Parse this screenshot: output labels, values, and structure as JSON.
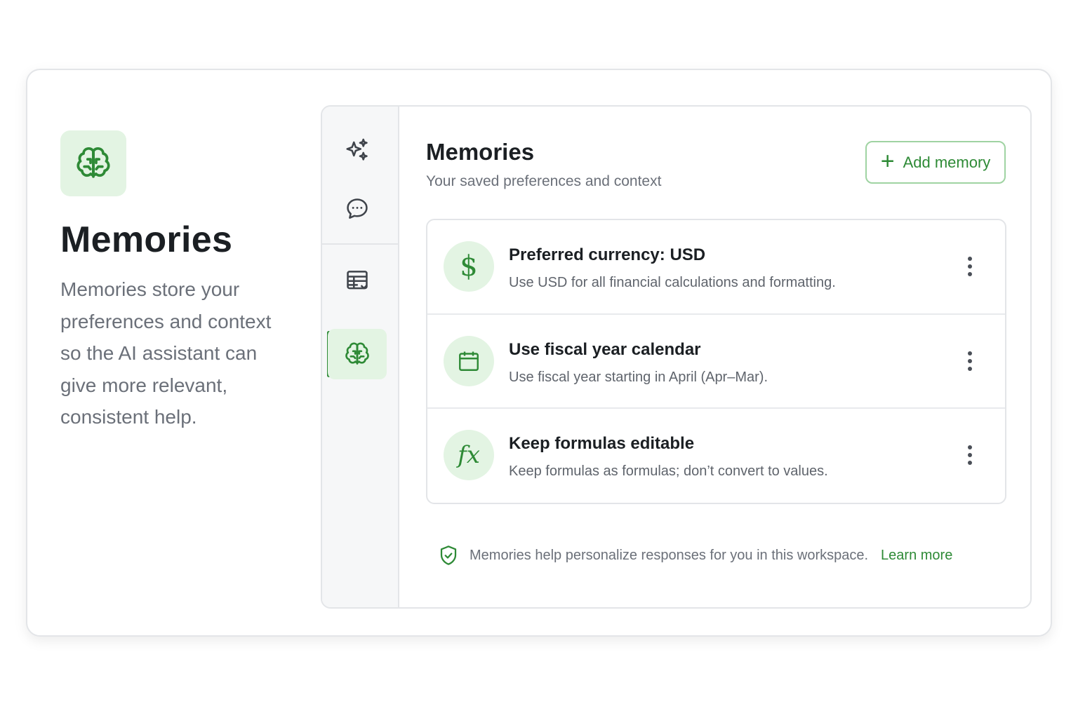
{
  "intro": {
    "icon": "brain-icon",
    "title": "Memories",
    "description": "Memories store your preferences and context so the AI assistant can give more relevant, consistent help."
  },
  "rail": {
    "items": [
      {
        "icon": "sparkles-icon",
        "active": false
      },
      {
        "icon": "chat-bubble-icon",
        "active": false
      },
      {
        "icon": "table-icon",
        "active": false
      },
      {
        "icon": "brain-icon",
        "active": true
      }
    ]
  },
  "main": {
    "title": "Memories",
    "subtitle": "Your saved preferences and context",
    "add_button": {
      "label": "Add memory",
      "icon": "plus-icon"
    }
  },
  "memories": [
    {
      "icon": "dollar-icon",
      "glyph": "$",
      "title": "Preferred currency: USD",
      "description": "Use USD for all financial calculations and formatting."
    },
    {
      "icon": "calendar-icon",
      "title": "Use fiscal year calendar",
      "description": "Use fiscal year starting in April (Apr–Mar)."
    },
    {
      "icon": "function-icon",
      "glyph": "fx",
      "title": "Keep formulas editable",
      "description": "Keep formulas as formulas; don’t convert to values."
    }
  ],
  "footer": {
    "icon": "shield-check-icon",
    "text": "Memories help personalize responses for you in this workspace.",
    "link_label": "Learn more"
  },
  "colors": {
    "accent": "#2e8a36",
    "accent_soft": "#e3f4e3",
    "border": "#e3e5e8"
  }
}
